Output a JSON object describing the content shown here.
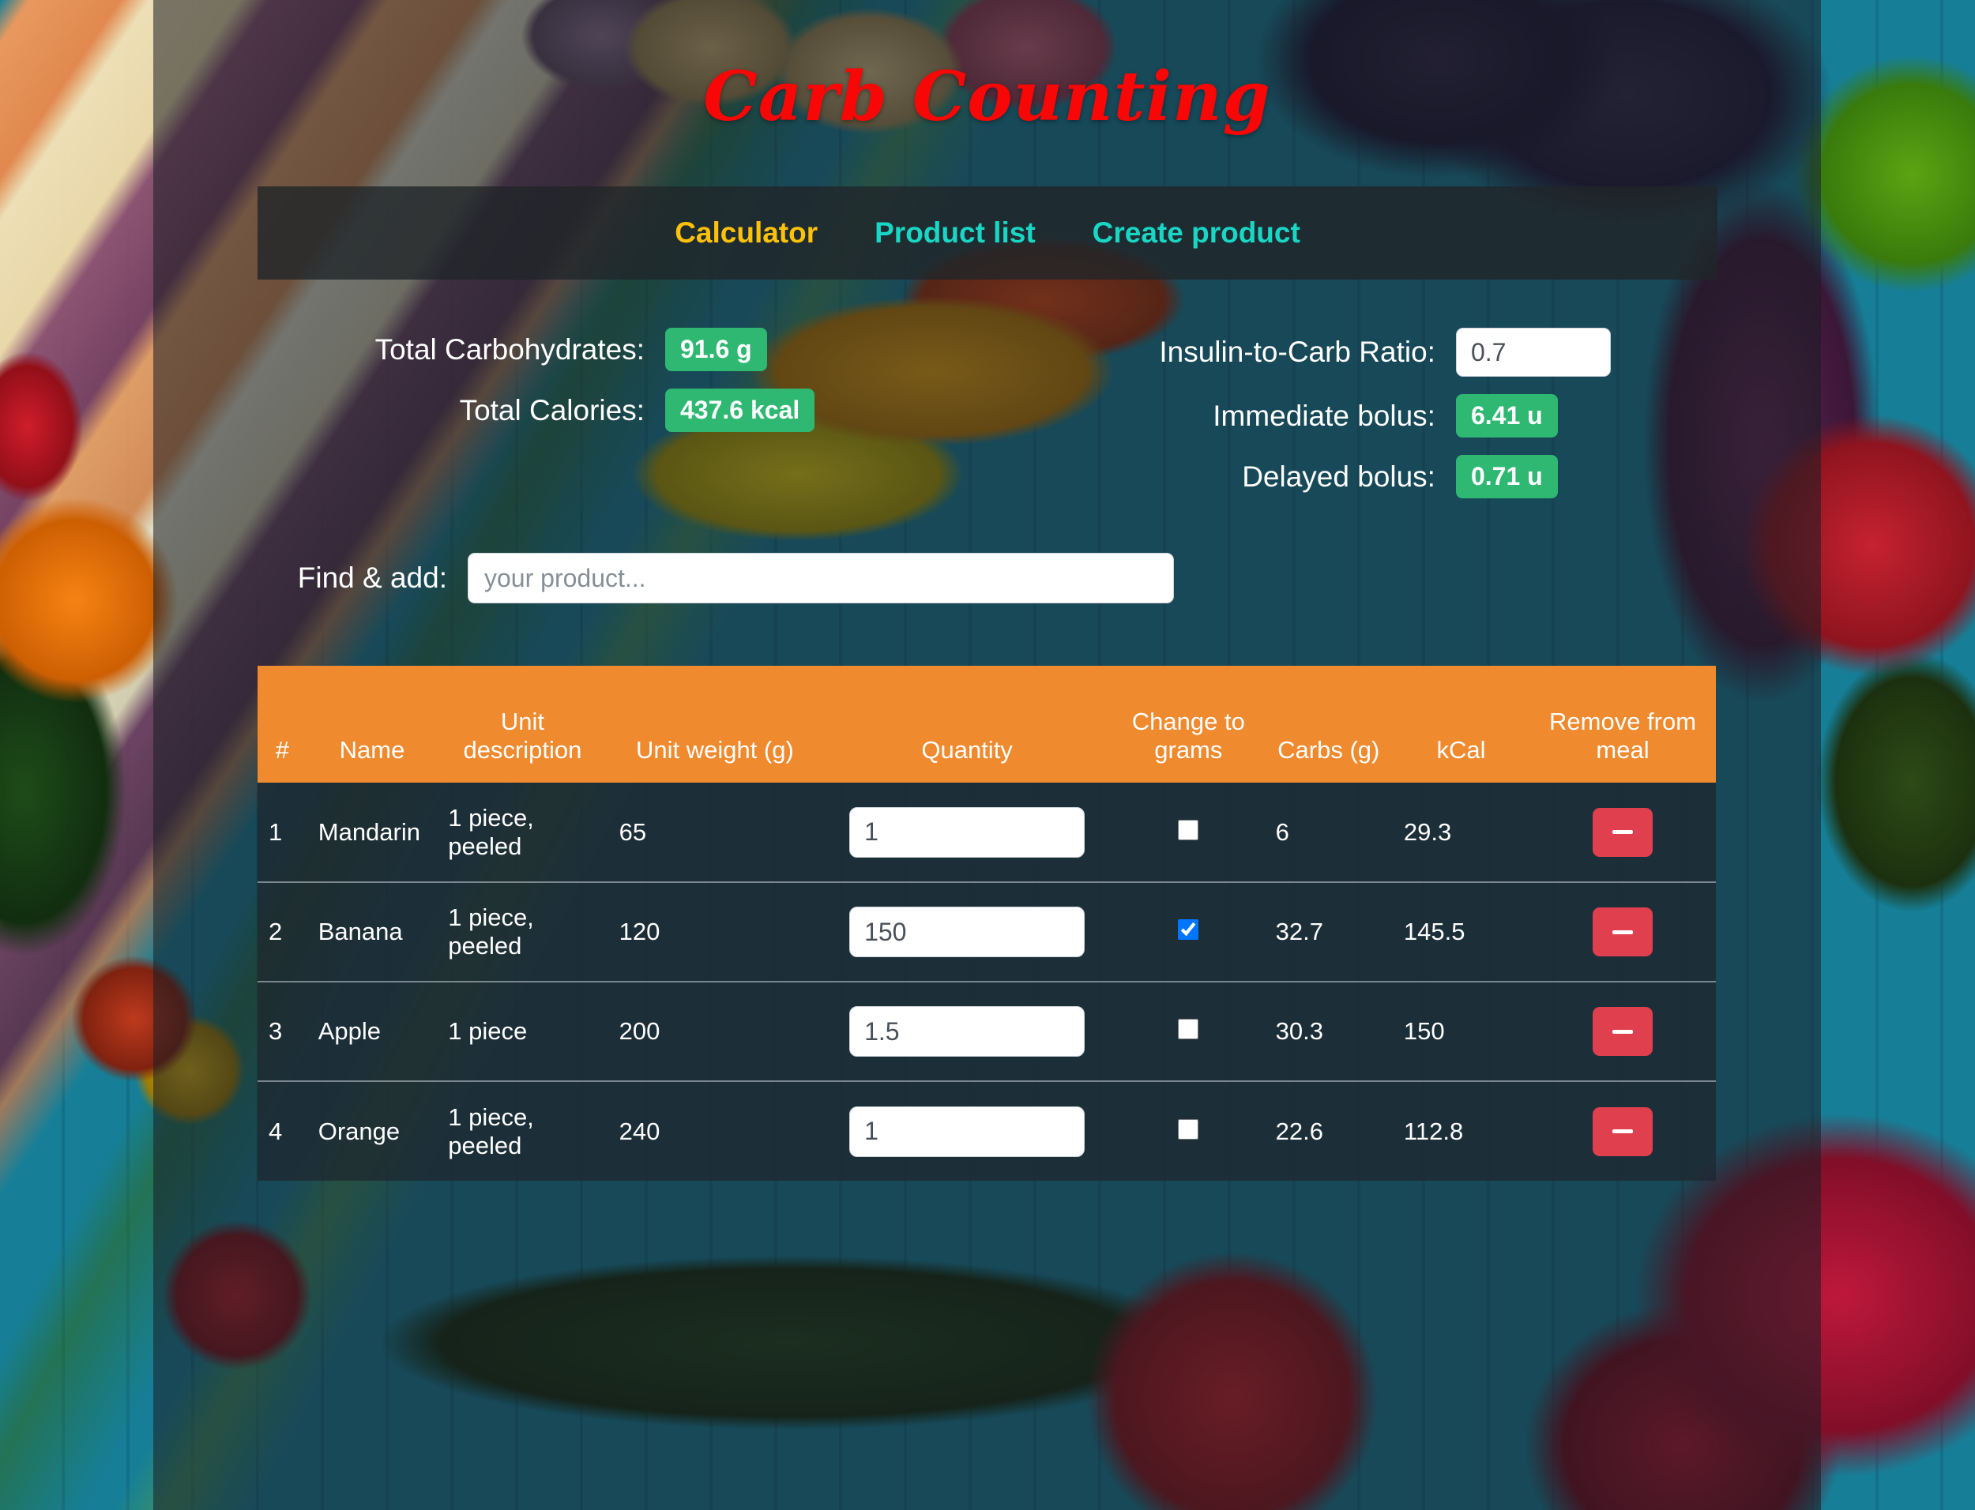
{
  "app": {
    "title": "Carb Counting",
    "title_color": "#f90606",
    "overlay_color": "#1a1e24",
    "accent_orange": "#ef8a2e",
    "accent_green": "#2eb872",
    "accent_red": "#e03f4e",
    "accent_yellow": "#ffc107",
    "accent_cyan": "#19d7c4"
  },
  "nav": {
    "items": [
      {
        "label": "Calculator",
        "active": true
      },
      {
        "label": "Product list",
        "active": false
      },
      {
        "label": "Create product",
        "active": false
      }
    ]
  },
  "summary": {
    "left": [
      {
        "label": "Total Carbohydrates:",
        "value": "91.6 g"
      },
      {
        "label": "Total Calories:",
        "value": "437.6 kcal"
      }
    ],
    "right": {
      "ratio_label": "Insulin-to-Carb Ratio:",
      "ratio_value": "0.7",
      "immediate_label": "Immediate bolus:",
      "immediate_value": "6.41 u",
      "delayed_label": "Delayed bolus:",
      "delayed_value": "0.71 u"
    }
  },
  "find_add": {
    "label": "Find & add:",
    "placeholder": "your product...",
    "value": ""
  },
  "table": {
    "headers": {
      "index": "#",
      "name": "Name",
      "unit_description": "Unit description",
      "unit_weight": "Unit weight (g)",
      "quantity": "Quantity",
      "change_to_grams": "Change to grams",
      "carbs": "Carbs (g)",
      "kcal": "kCal",
      "remove": "Remove from meal"
    },
    "rows": [
      {
        "index": "1",
        "name": "Mandarin",
        "unit_description": "1 piece, peeled",
        "unit_weight": "65",
        "quantity": "1",
        "change_to_grams": false,
        "carbs": "6",
        "kcal": "29.3"
      },
      {
        "index": "2",
        "name": "Banana",
        "unit_description": "1 piece, peeled",
        "unit_weight": "120",
        "quantity": "150",
        "change_to_grams": true,
        "carbs": "32.7",
        "kcal": "145.5"
      },
      {
        "index": "3",
        "name": "Apple",
        "unit_description": "1 piece",
        "unit_weight": "200",
        "quantity": "1.5",
        "change_to_grams": false,
        "carbs": "30.3",
        "kcal": "150"
      },
      {
        "index": "4",
        "name": "Orange",
        "unit_description": "1 piece, peeled",
        "unit_weight": "240",
        "quantity": "1",
        "change_to_grams": false,
        "carbs": "22.6",
        "kcal": "112.8"
      }
    ]
  }
}
